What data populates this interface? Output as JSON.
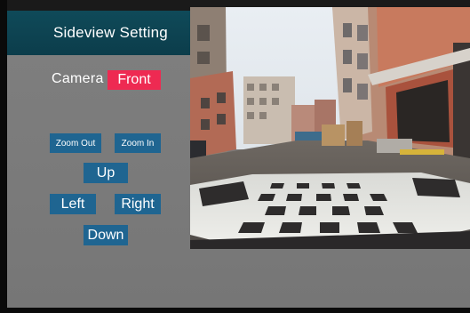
{
  "panel": {
    "title": "Sideview Setting",
    "camera_label": "Camera",
    "camera_value": "Front"
  },
  "controls": {
    "zoom_out": "Zoom Out",
    "zoom_in": "Zoom In",
    "up": "Up",
    "left": "Left",
    "right": "Right",
    "down": "Down"
  },
  "colors": {
    "title_bg": "#0c4452",
    "selected_bg": "#ee2a52",
    "button_bg": "#1f6591",
    "panel_bg": "#7d7d7d"
  }
}
